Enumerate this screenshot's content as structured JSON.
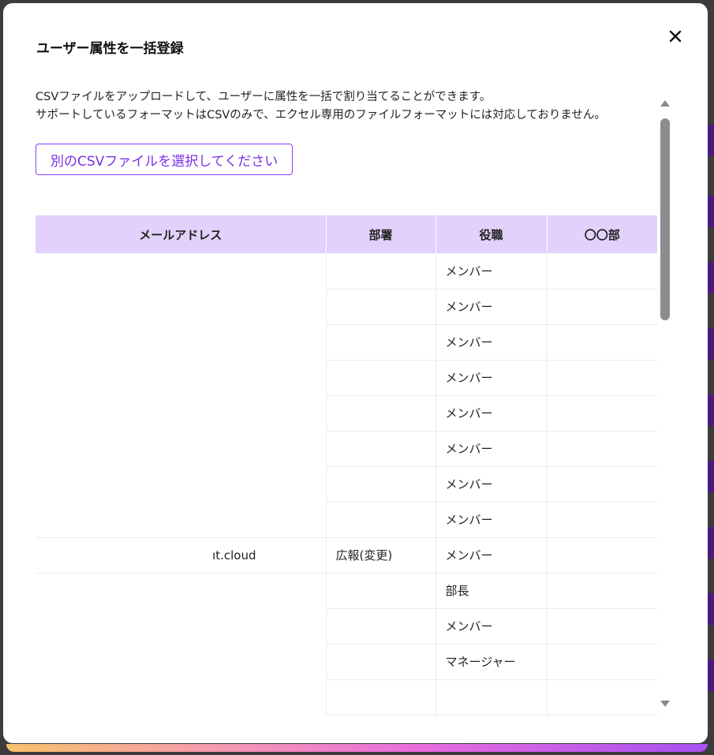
{
  "modal": {
    "title": "ユーザー属性を一括登録",
    "description_line1": "CSVファイルをアップロードして、ユーザーに属性を一括で割り当てることができます。",
    "description_line2": "サポートしているフォーマットはCSVのみで、エクセル専用のファイルフォーマットには対応しておりません。",
    "select_file_label": "別のCSVファイルを選択してください",
    "close_icon": "close-icon"
  },
  "table": {
    "headers": [
      "メールアドレス",
      "部署",
      "役職",
      "〇〇部"
    ],
    "rows": [
      {
        "email": "",
        "department": "",
        "position": "メンバー",
        "custom": ""
      },
      {
        "email": "",
        "department": "",
        "position": "メンバー",
        "custom": ""
      },
      {
        "email": "",
        "department": "",
        "position": "メンバー",
        "custom": ""
      },
      {
        "email": "",
        "department": "",
        "position": "メンバー",
        "custom": ""
      },
      {
        "email": "",
        "department": "",
        "position": "メンバー",
        "custom": ""
      },
      {
        "email": "",
        "department": "",
        "position": "メンバー",
        "custom": ""
      },
      {
        "email": "",
        "department": "",
        "position": "メンバー",
        "custom": ""
      },
      {
        "email": "",
        "department": "",
        "position": "メンバー",
        "custom": ""
      },
      {
        "email": "ıt.cloud",
        "department": "広報(変更)",
        "position": "メンバー",
        "custom": ""
      },
      {
        "email": "",
        "department": "",
        "position": "部長",
        "custom": ""
      },
      {
        "email": "",
        "department": "",
        "position": "メンバー",
        "custom": ""
      },
      {
        "email": "",
        "department": "",
        "position": "マネージャー",
        "custom": ""
      },
      {
        "email": "",
        "department": "",
        "position": "",
        "custom": ""
      }
    ]
  },
  "colors": {
    "accent": "#7a2fe8",
    "header_bg": "#e2d2fb"
  }
}
